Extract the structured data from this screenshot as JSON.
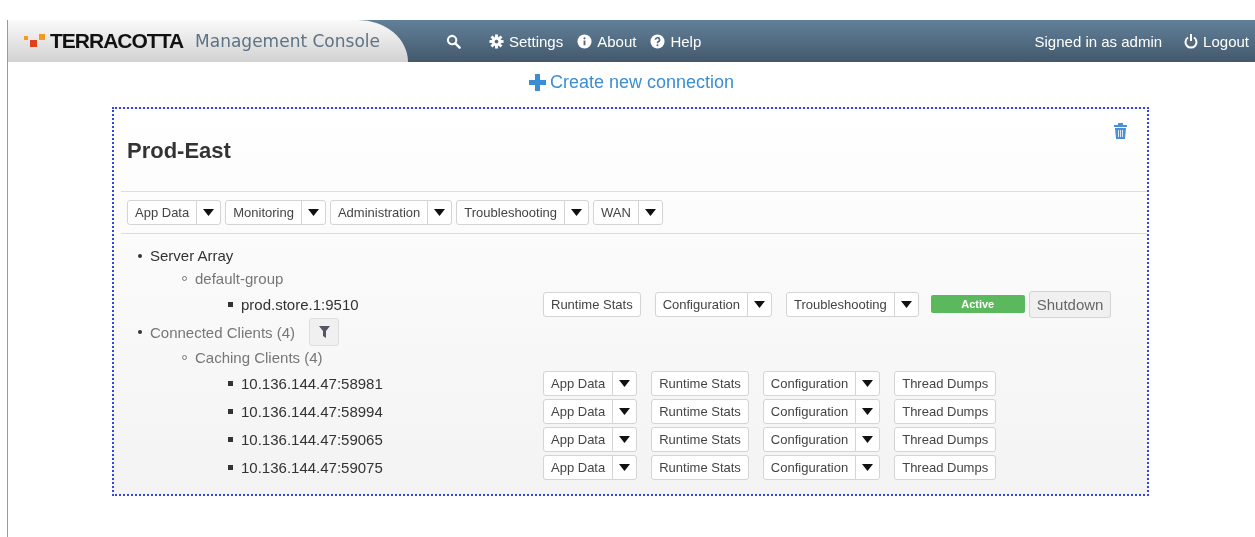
{
  "header": {
    "logo_text": "TERRACOTTA",
    "product": "Management Console",
    "nav": [
      {
        "kind": "search"
      },
      {
        "kind": "settings",
        "label": "Settings"
      },
      {
        "kind": "about",
        "label": "About"
      },
      {
        "kind": "help",
        "label": "Help"
      }
    ],
    "user": "Signed in as admin",
    "logout": "Logout"
  },
  "create_link": "Create new connection",
  "connection": {
    "name": "Prod-East",
    "menus": [
      {
        "label": "App Data"
      },
      {
        "label": "Monitoring"
      },
      {
        "label": "Administration"
      },
      {
        "label": "Troubleshooting"
      },
      {
        "label": "WAN"
      }
    ],
    "tree": [
      {
        "label": "Server Array",
        "dimmed": false,
        "children": [
          {
            "label": "default-group",
            "children": [
              {
                "label": "prod.store.1:9510",
                "actions": [
                  {
                    "kind": "button",
                    "label": "Runtime Stats"
                  },
                  {
                    "kind": "split",
                    "label": "Configuration"
                  },
                  {
                    "kind": "split",
                    "label": "Troubleshooting"
                  },
                  {
                    "kind": "status",
                    "label": "Active"
                  },
                  {
                    "kind": "shutdown",
                    "label": "Shutdown"
                  }
                ]
              }
            ]
          }
        ]
      },
      {
        "label": "Connected Clients (4)",
        "dimmed": true,
        "filter": true,
        "children": [
          {
            "label": "Caching Clients (4)",
            "children": [
              {
                "label": "10.136.144.47:58981",
                "actions": [
                  {
                    "kind": "split",
                    "label": "App Data"
                  },
                  {
                    "kind": "button",
                    "label": "Runtime Stats"
                  },
                  {
                    "kind": "split",
                    "label": "Configuration"
                  },
                  {
                    "kind": "button",
                    "label": "Thread Dumps"
                  }
                ]
              },
              {
                "label": "10.136.144.47:58994",
                "actions": [
                  {
                    "kind": "split",
                    "label": "App Data"
                  },
                  {
                    "kind": "button",
                    "label": "Runtime Stats"
                  },
                  {
                    "kind": "split",
                    "label": "Configuration"
                  },
                  {
                    "kind": "button",
                    "label": "Thread Dumps"
                  }
                ]
              },
              {
                "label": "10.136.144.47:59065",
                "actions": [
                  {
                    "kind": "split",
                    "label": "App Data"
                  },
                  {
                    "kind": "button",
                    "label": "Runtime Stats"
                  },
                  {
                    "kind": "split",
                    "label": "Configuration"
                  },
                  {
                    "kind": "button",
                    "label": "Thread Dumps"
                  }
                ]
              },
              {
                "label": "10.136.144.47:59075",
                "actions": [
                  {
                    "kind": "split",
                    "label": "App Data"
                  },
                  {
                    "kind": "button",
                    "label": "Runtime Stats"
                  },
                  {
                    "kind": "split",
                    "label": "Configuration"
                  },
                  {
                    "kind": "button",
                    "label": "Thread Dumps"
                  }
                ]
              }
            ]
          }
        ]
      }
    ]
  }
}
